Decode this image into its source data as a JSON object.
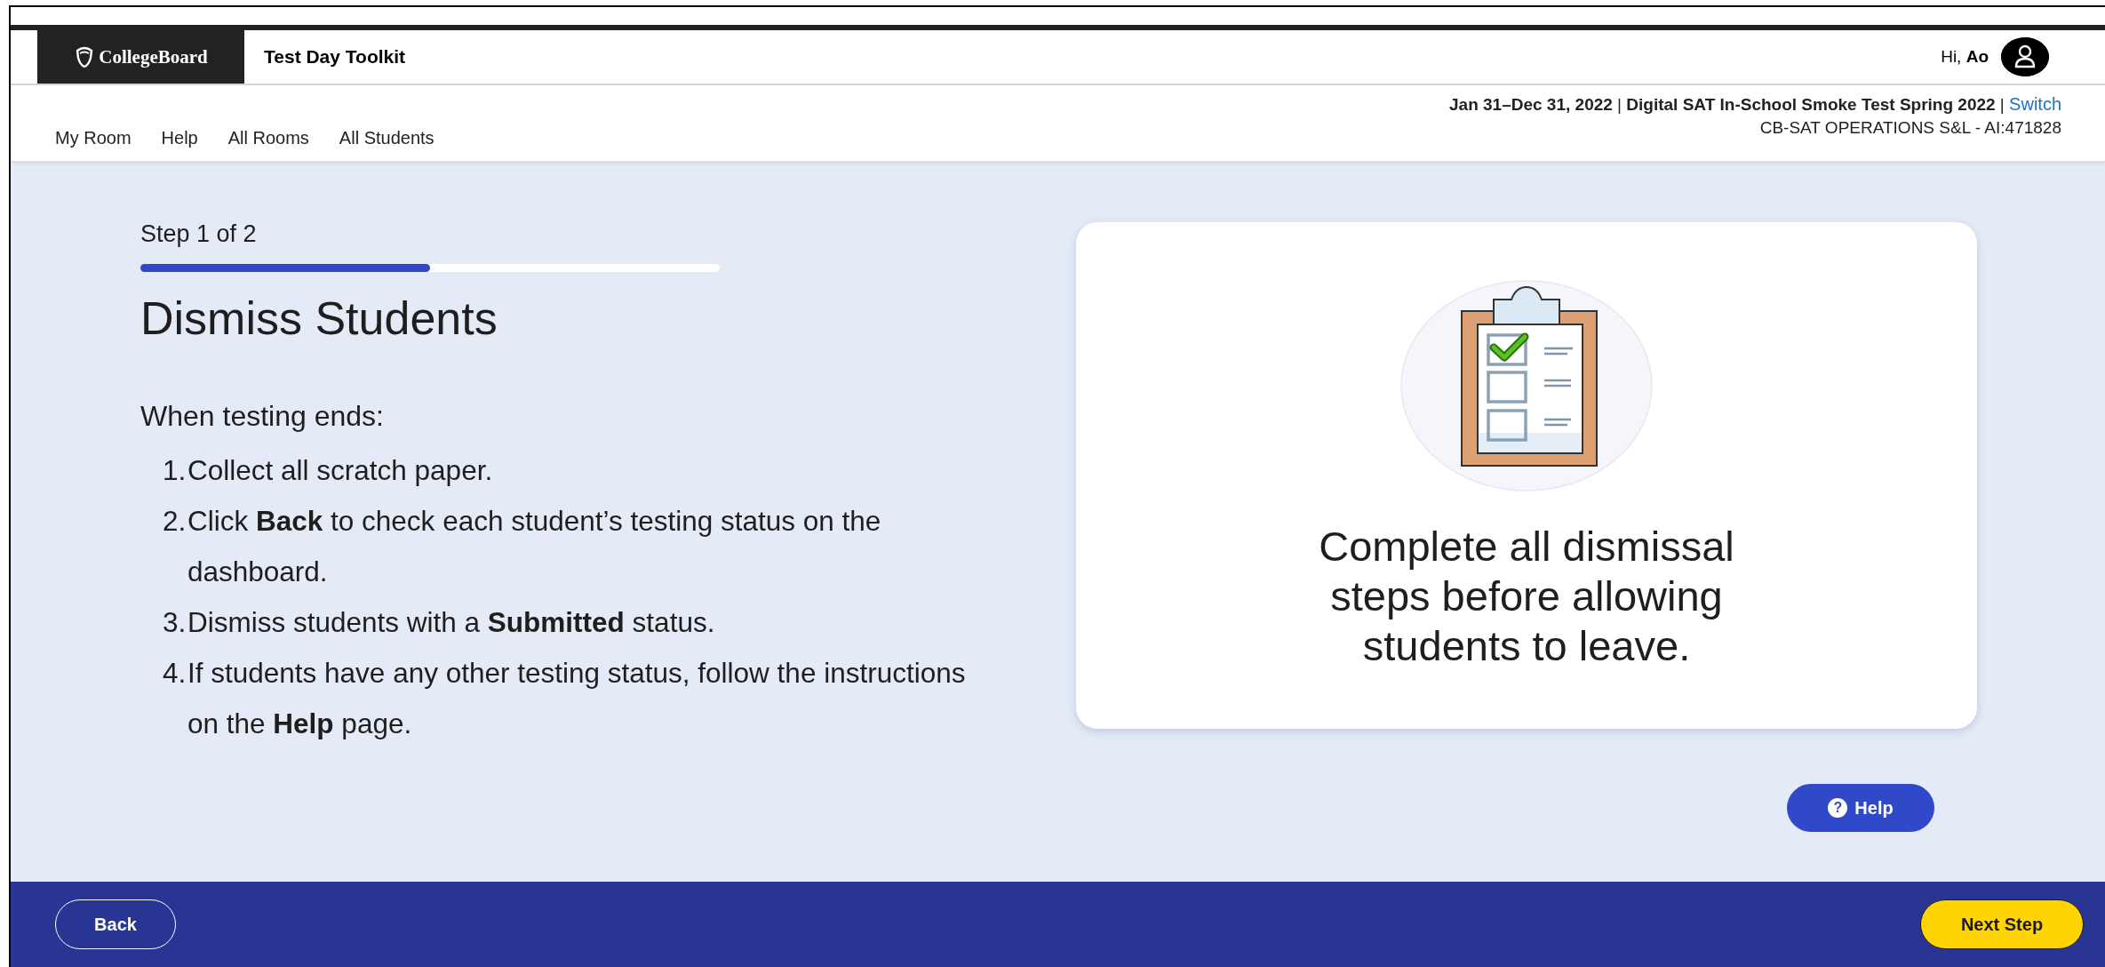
{
  "header": {
    "logo": "CollegeBoard",
    "app_title": "Test Day Toolkit",
    "greeting": "Hi, **Ao**"
  },
  "nav": [
    "My Room",
    "Help",
    "All Rooms",
    "All Students"
  ],
  "event": {
    "details": "**Jan 31–Dec 31, 2022** | **Digital SAT In-School Smoke Test Spring 2022** |",
    "link": "Switch",
    "organization": "CB-SAT OPERATIONS S&L - AI:471828"
  },
  "step": {
    "label": "Step 1 of 2",
    "level": 0.5
  },
  "heading": "Dismiss Students",
  "intro": "When testing ends:",
  "instructions": [
    {
      "number": "1.",
      "text": "Collect all scratch paper."
    },
    {
      "number": "2.",
      "text": "Click **Back** to check each student’s testing status on the dashboard."
    },
    {
      "number": "3.",
      "text": "Dismiss students with a **Submitted** status."
    },
    {
      "number": "4.",
      "text": "If students have any other testing status, follow the instructions on the **Help** page."
    }
  ],
  "card": {
    "message": "Complete all dismissal steps before allowing students to leave."
  },
  "help_button": {
    "icon": "?",
    "label": "Help"
  },
  "footer": {
    "back": "Back",
    "next": "Next Step"
  }
}
